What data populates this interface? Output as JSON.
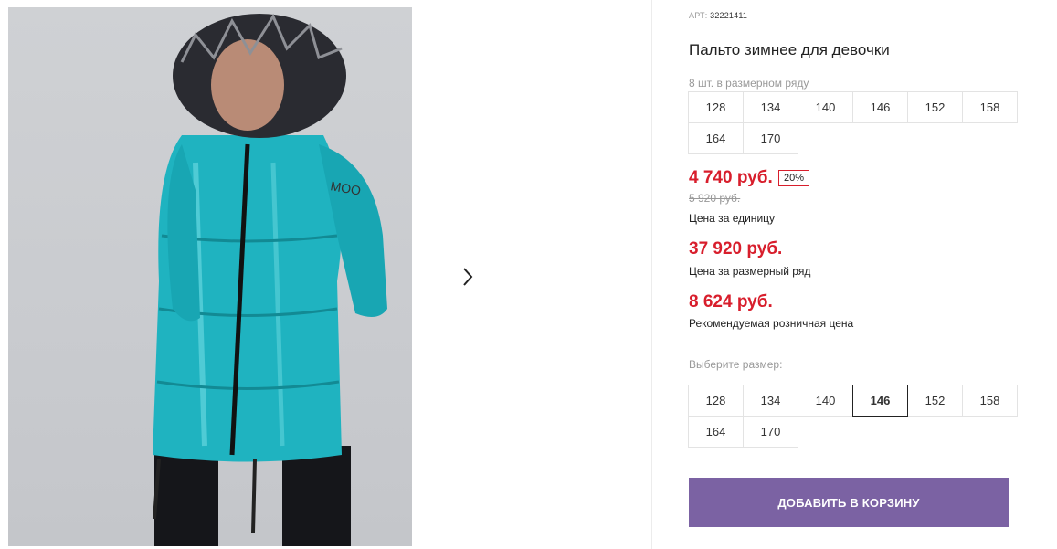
{
  "product": {
    "article_label": "АРТ:",
    "article_number": "32221411",
    "title": "Пальто зимнее для девочки"
  },
  "pack": {
    "label": "8 шт. в размерном ряду",
    "sizes": [
      "128",
      "134",
      "140",
      "146",
      "152",
      "158",
      "164",
      "170"
    ]
  },
  "pricing": {
    "unit_price": "4 740 руб.",
    "discount": "20%",
    "old_price": "5 920 руб.",
    "unit_caption": "Цена за единицу",
    "pack_price": "37 920 руб.",
    "pack_caption": "Цена за размерный ряд",
    "retail_price": "8 624 руб.",
    "retail_caption": "Рекомендуемая розничная цена"
  },
  "size_select": {
    "label": "Выберите размер:",
    "sizes": [
      "128",
      "134",
      "140",
      "146",
      "152",
      "158",
      "164",
      "170"
    ],
    "selected": "146"
  },
  "cart": {
    "label": "ДОБАВИТЬ В КОРЗИНУ"
  },
  "gallery": {
    "next_icon": "chevron-right-icon"
  },
  "colors": {
    "accent": "#7b62a3",
    "price": "#d81e2c",
    "coat": "#1fb3c0"
  }
}
